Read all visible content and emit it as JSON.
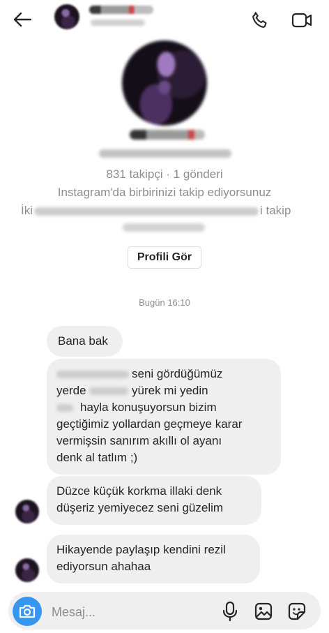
{
  "header": {
    "back_icon": "arrow-left-icon",
    "call_icon": "phone-icon",
    "video_icon": "video-camera-icon"
  },
  "profile": {
    "stats": "831 takipçi · 1 gönderi",
    "mutual_line1": "Instagram'da birbirinizi takip ediyorsunuz",
    "mutual_line2_prefix": "İki",
    "mutual_line2_suffix": "i takip",
    "view_profile_label": "Profili Gör"
  },
  "thread": {
    "timestamp": "Bugün 16:10",
    "messages": [
      {
        "lines": [
          "Bana bak"
        ]
      },
      {
        "lines": [
          "seni gördüğümüz",
          "yerde",
          "yürek mi yedin",
          "hayla konuşuyorsun bizim",
          "geçtiğimiz yollardan geçmeye karar",
          "vermişsin sanırım akıllı ol  ayanı",
          "denk al tatlım ;)"
        ]
      },
      {
        "lines": [
          "Düzce küçük korkma illaki denk",
          "düşeriz  yemiyecez seni  güzelim"
        ]
      },
      {
        "lines": [
          "Hikayende paylaşıp kendini rezil",
          "ediyorsun ahahaa"
        ]
      }
    ]
  },
  "composer": {
    "placeholder": "Mesaj...",
    "camera_icon": "camera-icon",
    "mic_icon": "microphone-icon",
    "gallery_icon": "gallery-icon",
    "sticker_icon": "sticker-icon"
  },
  "colors": {
    "accent": "#3797f0",
    "bubble": "#efefef",
    "muted_text": "#8e8e8e"
  }
}
